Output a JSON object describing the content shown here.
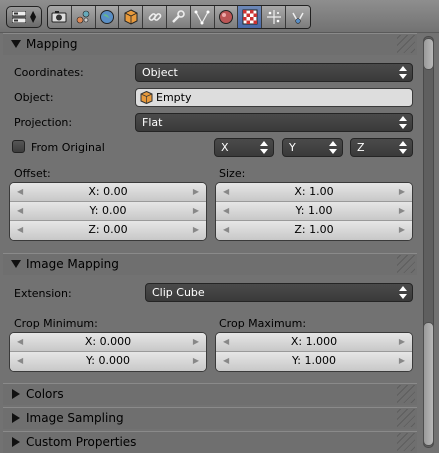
{
  "header": {
    "editor_type_icon": "properties-editor-icon",
    "tabs": [
      {
        "name": "render-icon",
        "active": false
      },
      {
        "name": "scene-icon",
        "active": false
      },
      {
        "name": "world-icon",
        "active": false
      },
      {
        "name": "object-icon",
        "active": false
      },
      {
        "name": "constraints-icon",
        "active": false
      },
      {
        "name": "modifiers-icon",
        "active": false
      },
      {
        "name": "object-data-icon",
        "active": false
      },
      {
        "name": "material-icon",
        "active": false
      },
      {
        "name": "texture-icon",
        "active": true
      },
      {
        "name": "particles-icon",
        "active": false
      },
      {
        "name": "physics-icon",
        "active": false
      }
    ]
  },
  "mapping": {
    "title": "Mapping",
    "coordinates_label": "Coordinates:",
    "coordinates_value": "Object",
    "object_label": "Object:",
    "object_value": "Empty",
    "projection_label": "Projection:",
    "projection_value": "Flat",
    "from_original_label": "From Original",
    "from_original_checked": false,
    "axis_x": "X",
    "axis_y": "Y",
    "axis_z": "Z",
    "offset_label": "Offset:",
    "offset_x": "X: 0.00",
    "offset_y": "Y: 0.00",
    "offset_z": "Z: 0.00",
    "size_label": "Size:",
    "size_x": "X: 1.00",
    "size_y": "Y: 1.00",
    "size_z": "Z: 1.00"
  },
  "image_mapping": {
    "title": "Image Mapping",
    "extension_label": "Extension:",
    "extension_value": "Clip Cube",
    "crop_min_label": "Crop Minimum:",
    "crop_min_x": "X: 0.000",
    "crop_min_y": "Y: 0.000",
    "crop_max_label": "Crop Maximum:",
    "crop_max_x": "X: 1.000",
    "crop_max_y": "Y: 1.000"
  },
  "collapsed_panels": {
    "colors": "Colors",
    "image_sampling": "Image Sampling",
    "custom_properties": "Custom Properties"
  },
  "colors": {
    "active_tab": "#4a6aa8",
    "dropdown_bg": "#3d3d3d",
    "panel_bg": "#727272"
  }
}
